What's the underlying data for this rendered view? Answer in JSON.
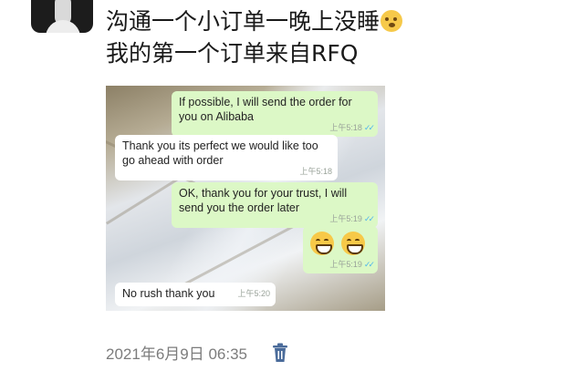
{
  "post": {
    "line1": "沟通一个小订单一晚上没睡",
    "line1_emoji": "grimacing-face-emoji",
    "line2": "我的第一个订单来自RFQ"
  },
  "chat": {
    "messages": [
      {
        "direction": "outgoing",
        "text": "If possible, I will send the order for you on Alibaba",
        "time": "上午5:18",
        "read": true
      },
      {
        "direction": "incoming",
        "text": "Thank you  its perfect we would like too go ahead with order",
        "time": "上午5:18"
      },
      {
        "direction": "outgoing",
        "text": "OK, thank you for your trust, I will send you the order later",
        "time": "上午5:19",
        "read": true
      },
      {
        "direction": "outgoing",
        "emoji": [
          "grinning-face-emoji",
          "grinning-face-emoji"
        ],
        "time": "上午5:19",
        "read": true
      },
      {
        "direction": "incoming",
        "text": "No rush thank you",
        "time": "上午5:20"
      }
    ]
  },
  "footer": {
    "timestamp": "2021年6月9日 06:35",
    "delete_icon": "trash-icon"
  },
  "colors": {
    "outgoing_bubble": "#dcf8c6",
    "incoming_bubble": "#ffffff",
    "read_check": "#4fb6ec",
    "timestamp_text": "#7c7c7c"
  }
}
